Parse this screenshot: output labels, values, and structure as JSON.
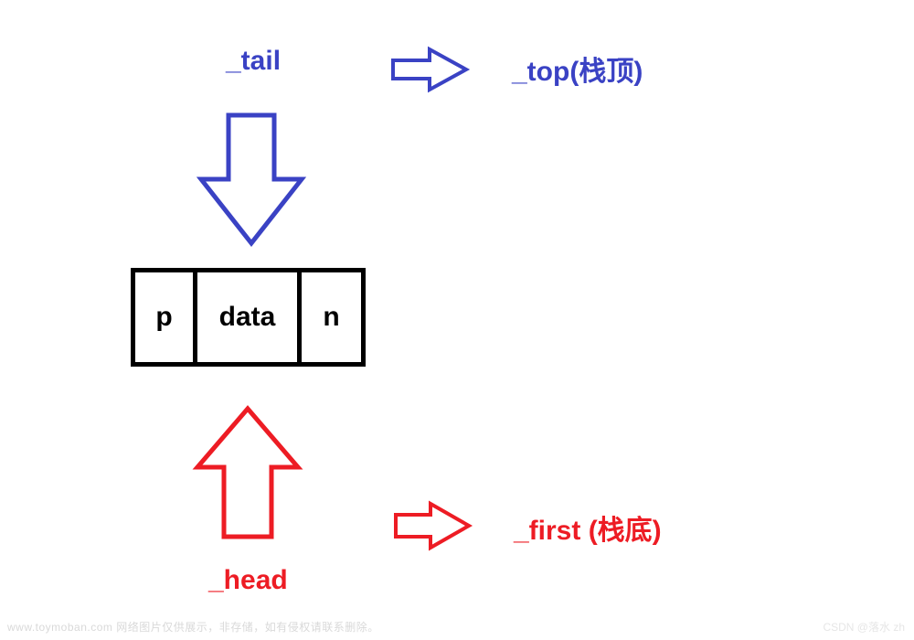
{
  "labels": {
    "tail": "_tail",
    "top": "_top(栈顶)",
    "head": "_head",
    "first": "_first (栈底)"
  },
  "node": {
    "p": "p",
    "data": "data",
    "n": "n"
  },
  "footer": {
    "left": "www.toymoban.com 网络图片仅供展示，非存储，如有侵权请联系删除。",
    "right": "CSDN @落水 zh"
  },
  "colors": {
    "blue": "#3a42c4",
    "red": "#ed1c24",
    "black": "#000000"
  }
}
